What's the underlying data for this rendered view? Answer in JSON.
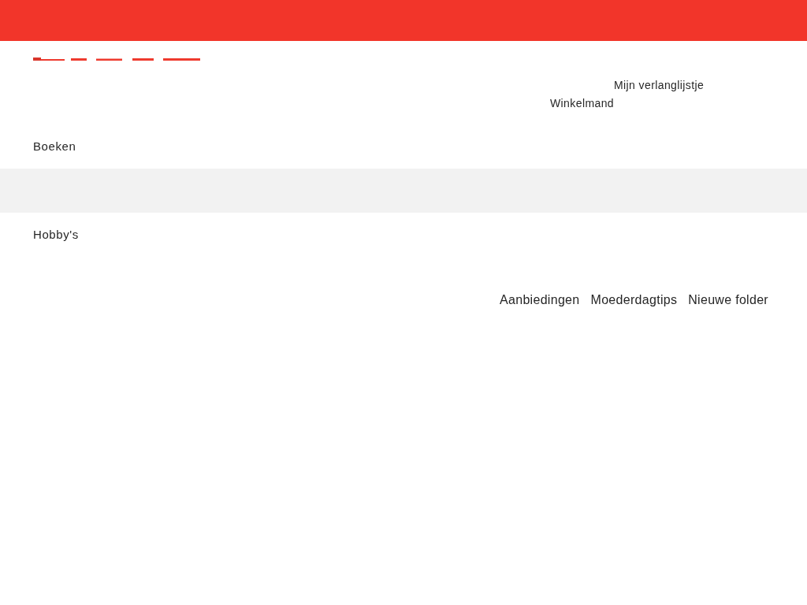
{
  "header": {
    "wishlist_link": "Mijn verlanglijstje",
    "cart_link": "Winkelmand"
  },
  "main_menu": {
    "items": [
      {
        "label": "Boeken"
      }
    ]
  },
  "secondary_menu": {
    "items": [
      {
        "label": "Hobby's"
      }
    ]
  },
  "promo_links": [
    {
      "label": "Aanbiedingen"
    },
    {
      "label": "Moederdagtips"
    },
    {
      "label": "Nieuwe folder"
    }
  ]
}
